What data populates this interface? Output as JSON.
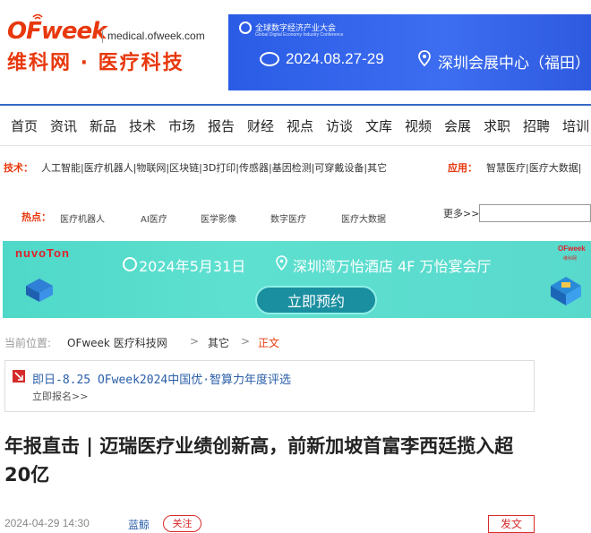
{
  "header": {
    "logo_text": "OFweek",
    "domain": "medical.ofweek.com",
    "site_name": "维科网 · 医疗科技"
  },
  "top_banner": {
    "org_title": "全球数字经济产业大会",
    "org_title_en": "Global Digital Economy Industry Conference",
    "date": "2024.08.27-29",
    "venue": "深圳会展中心（福田）",
    "background": "#2a5ce6"
  },
  "nav": {
    "items": [
      "首页",
      "资讯",
      "新品",
      "技术",
      "市场",
      "报告",
      "财经",
      "视点",
      "访谈",
      "文库",
      "视频",
      "会展",
      "求职",
      "招聘",
      "培训"
    ],
    "accent": "#3469c8"
  },
  "tech": {
    "label": "技术：",
    "items": "人工智能|医疗机器人|物联网|区块链|3D打印|传感器|基因检测|可穿戴设备|其它",
    "app_label": "应用：",
    "app_items": "智慧医疗|医疗大数据|"
  },
  "hot": {
    "label": "热点：",
    "items": [
      "医疗机器人",
      "AI医疗",
      "医学影像",
      "数字医疗",
      "医疗大数据"
    ],
    "more": "更多>>",
    "search_placeholder": ""
  },
  "ad_banner": {
    "brand": "nuvoTon",
    "date": "2024年5月31日",
    "venue": "深圳湾万怡酒店 4F 万怡宴会厅",
    "button": "立即预约",
    "right_logo": "OFweek",
    "right_sub": "维科网",
    "background": "#4fd8c8"
  },
  "breadcrumb": {
    "label": "当前位置:",
    "site": "OFweek 医疗科技网",
    "sep1": ">",
    "category": "其它",
    "sep2": ">",
    "current": "正文"
  },
  "promo": {
    "title": "即日-8.25 OFweek2024中国优·智算力年度评选",
    "subtitle": "立即报名>>"
  },
  "article": {
    "title": "年报直击 | 迈瑞医疗业绩创新高，前新加坡首富李西廷揽入超20亿",
    "date": "2024-04-29 14:30",
    "author": "蓝鲸",
    "follow": "关注",
    "post": "发文"
  },
  "colors": {
    "brand_red": "#e8380d",
    "link_blue": "#2a5ea8"
  }
}
